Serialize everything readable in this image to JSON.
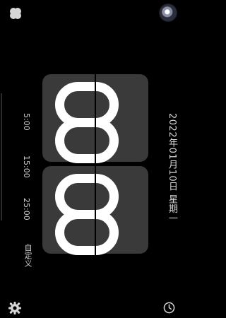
{
  "header": {
    "left_icon": "clover-icon",
    "avatar": "avatar-icon"
  },
  "clock": {
    "hours": "00",
    "minutes": "00"
  },
  "date": {
    "label": "2022年01月10日 星期一"
  },
  "timer_presets": [
    {
      "label": "5:00"
    },
    {
      "label": "15:00"
    },
    {
      "label": "25:00"
    },
    {
      "label": "自定义"
    }
  ],
  "footer": {
    "left_icon": "settings-icon",
    "right_icon": "clock-icon"
  },
  "colors": {
    "background": "#000000",
    "card": "#3a3a3a",
    "digit": "#ffffff",
    "text": "#d6d6d6"
  }
}
